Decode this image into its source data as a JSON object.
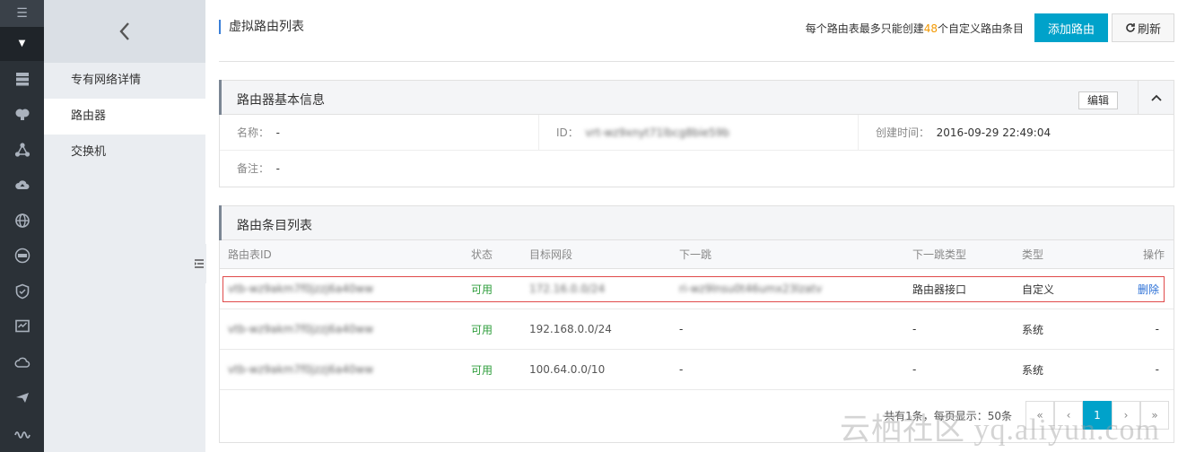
{
  "rail": {
    "top_icon": "menu-icon",
    "dropdown_icon": "caret-down-icon",
    "items": [
      "server-stack-icon",
      "brain-icon",
      "network-icon",
      "cloud-upload-icon",
      "globe-icon",
      "dns-icon",
      "shield-icon",
      "monitor-check-icon",
      "cloud-icon",
      "plane-icon",
      "wave-icon"
    ]
  },
  "subnav": {
    "back_icon": "chevron-left-icon",
    "items": [
      {
        "label": "专有网络详情"
      },
      {
        "label": "路由器"
      },
      {
        "label": "交换机"
      }
    ]
  },
  "header": {
    "title": "虚拟路由列表",
    "quota_prefix": "每个路由表最多只能创建",
    "quota_number": "48",
    "quota_suffix": "个自定义路由条目",
    "add_button": "添加路由",
    "refresh_button": "刷新"
  },
  "router_info": {
    "title": "路由器基本信息",
    "edit_button": "编辑",
    "name_label": "名称：",
    "name_value": "-",
    "id_label": "ID：",
    "id_value": "vrt-wz9xnyt71lbcg8bie59b",
    "created_label": "创建时间：",
    "created_value": "2016-09-29 22:49:04",
    "note_label": "备注：",
    "note_value": "-"
  },
  "route_table": {
    "title": "路由条目列表",
    "columns": [
      "路由表ID",
      "状态",
      "目标网段",
      "下一跳",
      "下一跳类型",
      "类型",
      "操作"
    ],
    "rows": [
      {
        "id": "vtb-wz9akm7f0jzzj6a40ww",
        "status": "可用",
        "cidr": "172.16.0.0/24",
        "next_hop": "ri-wz9lnsu0t46umx23lzatv",
        "next_hop_type": "路由器接口",
        "type": "自定义",
        "action": "删除"
      },
      {
        "id": "vtb-wz9akm7f0jzzj6a40ww",
        "status": "可用",
        "cidr": "192.168.0.0/24",
        "next_hop": "-",
        "next_hop_type": "-",
        "type": "系统",
        "action": "-"
      },
      {
        "id": "vtb-wz9akm7f0jzzj6a40ww",
        "status": "可用",
        "cidr": "100.64.0.0/10",
        "next_hop": "-",
        "next_hop_type": "-",
        "type": "系统",
        "action": "-"
      }
    ],
    "pagination": {
      "summary": "共有1条，每页显示：50条",
      "current_page": "1",
      "first": "«",
      "prev": "‹",
      "next": "›",
      "last": "»"
    }
  },
  "watermark": "云栖社区 yq.aliyun.com",
  "colors": {
    "accent": "#00a2ca",
    "ok": "#2e9d3b",
    "link": "#2a6fd6",
    "highlight_border": "#e04a4a",
    "quota_number": "#f39800"
  }
}
